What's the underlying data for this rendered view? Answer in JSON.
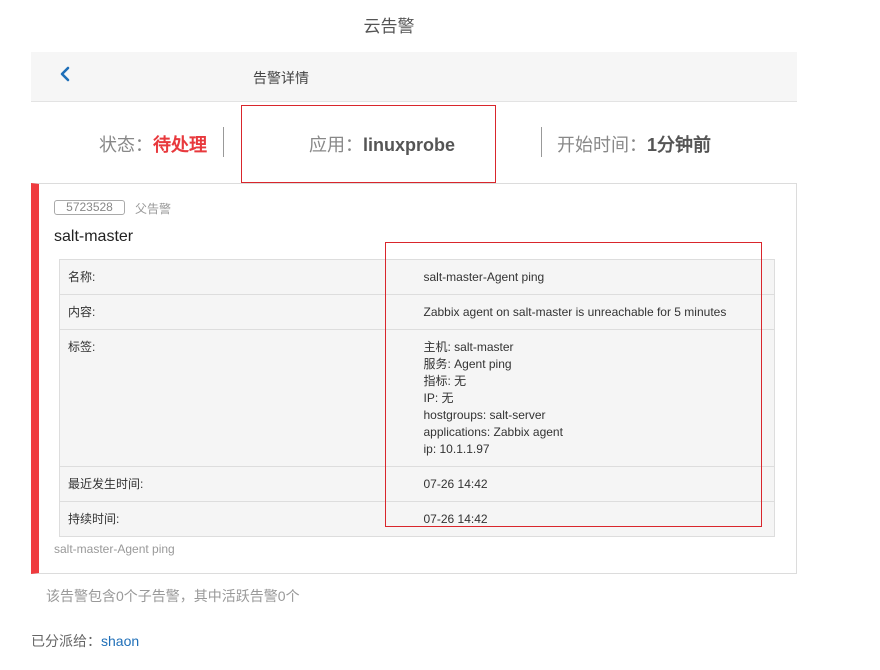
{
  "app": {
    "title": "云告警"
  },
  "navbar": {
    "back_icon": "chevron-left-icon",
    "title": "告警详情",
    "accent": "#1f6fb8"
  },
  "summary": {
    "status_label": "状态：",
    "status_value": "待处理",
    "app_label": "应用：",
    "app_value": "linuxprobe",
    "start_label": "开始时间：",
    "start_value": "1分钟前",
    "status_color": "#e8393d"
  },
  "alert": {
    "id": "5723528",
    "parent_label": "父告警",
    "title": "salt-master",
    "stripe_color": "#ef3b3f",
    "details": [
      {
        "key": "名称:",
        "value": "salt-master-Agent ping"
      },
      {
        "key": "内容:",
        "value": "Zabbix agent on salt-master is unreachable for 5 minutes"
      },
      {
        "key": "标签:",
        "tags": [
          "主机: salt-master",
          "服务: Agent ping",
          "指标: 无",
          "IP: 无",
          "hostgroups: salt-server",
          "applications: Zabbix agent",
          "ip: 10.1.1.97"
        ]
      },
      {
        "key": "最近发生时间:",
        "value": "07-26 14:42"
      },
      {
        "key": "持续时间:",
        "value": "07-26 14:42"
      }
    ],
    "footer": "salt-master-Agent ping"
  },
  "child_summary": "该告警包含0个子告警，其中活跃告警0个",
  "assignment": {
    "label": "已分派给：",
    "user": "shaon"
  }
}
